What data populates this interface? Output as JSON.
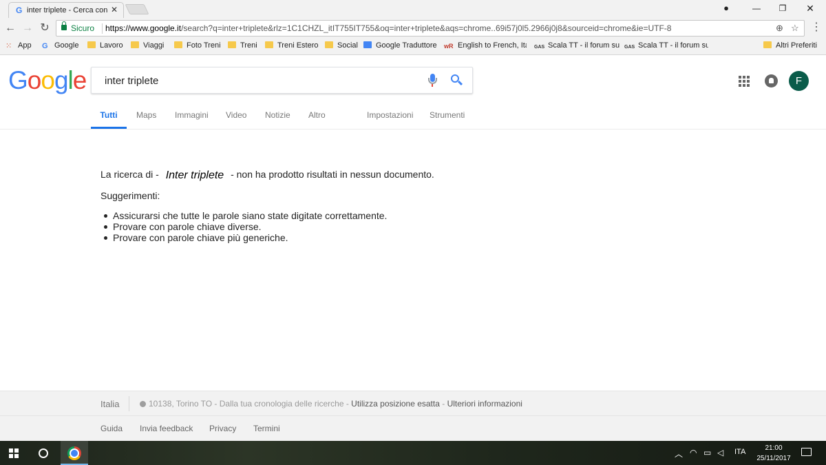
{
  "browser": {
    "tab_title": "inter triplete - Cerca con",
    "tab_favicon": "G",
    "secure_label": "Sicuro",
    "url_host": "https://www.google.it",
    "url_rest": "/search?q=inter+triplete&rlz=1C1CHZL_itIT755IT755&oq=inter+triplete&aqs=chrome..69i57j0l5.2966j0j8&sourceid=chrome&ie=UTF-8",
    "bookmarks": [
      {
        "label": "App",
        "icon": "apps-grid-icon"
      },
      {
        "label": "Google",
        "icon": "google-g-icon"
      },
      {
        "label": "Lavoro",
        "icon": "folder-icon"
      },
      {
        "label": "Viaggi",
        "icon": "folder-icon"
      },
      {
        "label": "Foto Treni",
        "icon": "folder-icon"
      },
      {
        "label": "Treni",
        "icon": "folder-icon"
      },
      {
        "label": "Treni Estero",
        "icon": "folder-icon"
      },
      {
        "label": "Social",
        "icon": "folder-icon"
      },
      {
        "label": "Google Traduttore",
        "icon": "translate-icon"
      },
      {
        "label": "English to French, Ita",
        "icon": "wordreference-icon"
      },
      {
        "label": "Scala TT - il forum su",
        "icon": "gas-icon"
      },
      {
        "label": "Scala TT - il forum su",
        "icon": "gas-icon"
      },
      {
        "label": "Altri Preferiti",
        "icon": "folder-icon"
      }
    ]
  },
  "google": {
    "logo_letters": [
      "G",
      "o",
      "o",
      "g",
      "l",
      "e"
    ],
    "logo_colors": [
      "#4285f4",
      "#ea4335",
      "#fbbc05",
      "#4285f4",
      "#34a853",
      "#ea4335"
    ],
    "query": "inter triplete",
    "avatar_letter": "F",
    "tabs": [
      "Tutti",
      "Maps",
      "Immagini",
      "Video",
      "Notizie",
      "Altro",
      "Impostazioni",
      "Strumenti"
    ],
    "active_tab": "Tutti"
  },
  "results": {
    "prefix": "La ricerca di -",
    "term": "Inter triplete",
    "suffix": "- non ha prodotto risultati in nessun documento.",
    "suggestions_title": "Suggerimenti:",
    "suggestions": [
      "Assicurarsi che tutte le parole siano state digitate correttamente.",
      "Provare con parole chiave diverse.",
      "Provare con parole chiave più generiche."
    ]
  },
  "footer": {
    "country": "Italia",
    "location_text": "10138, Torino TO - Dalla tua cronologia delle ricerche - ",
    "use_precise": "Utilizza posizione esatta",
    "dash": " - ",
    "more_info": "Ulteriori informazioni",
    "links": [
      "Guida",
      "Invia feedback",
      "Privacy",
      "Termini"
    ]
  },
  "taskbar": {
    "language": "ITA",
    "time": "21:00",
    "date": "25/11/2017"
  }
}
